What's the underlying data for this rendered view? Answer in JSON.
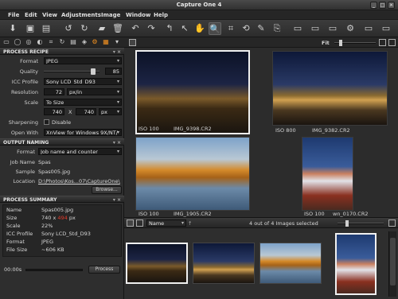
{
  "window": {
    "title": "Capture One 4",
    "buttons": [
      "_",
      "□",
      "×"
    ]
  },
  "menu": [
    "File",
    "Edit",
    "View",
    "Adjustments",
    "Image",
    "Window",
    "Help"
  ],
  "process_recipe": {
    "header": "PROCESS RECIPE",
    "format_label": "Format",
    "format_value": "JPEG",
    "quality_label": "Quality",
    "quality_value": "85",
    "icc_label": "ICC Profile",
    "icc_value": "Sony LCD_Std_D93",
    "resolution_label": "Resolution",
    "resolution_value": "72",
    "resolution_unit": "px/in",
    "scale_label": "Scale",
    "scale_value": "To Size",
    "width_value": "740",
    "x_sep": "X",
    "height_value": "740",
    "size_unit": "px",
    "sharpening_label": "Sharpening",
    "sharpening_value": "Disable",
    "openwith_label": "Open With",
    "openwith_value": "XnView for Windows 9X/NT/"
  },
  "output_naming": {
    "header": "OUTPUT NAMING",
    "format_label": "Format",
    "format_value": "Job name and counter",
    "jobname_label": "Job Name",
    "jobname_value": "Spas",
    "sample_label": "Sample",
    "sample_value": "Spas005.jpg",
    "location_label": "Location",
    "location_value": "D:\\Photos\\Kos...07\\CaptureOne\\",
    "browse_label": "Browse..."
  },
  "process_summary": {
    "header": "PROCESS SUMMARY",
    "rows": [
      {
        "label": "Name",
        "value": "Spas005.jpg"
      },
      {
        "label": "Size",
        "value": "740 x 494 px",
        "w": "740",
        "h": "494",
        "unit": "px"
      },
      {
        "label": "Scale",
        "value": "22%"
      },
      {
        "label": "ICC Profile",
        "value": "Sony LCD_Std_D93"
      },
      {
        "label": "Format",
        "value": "JPEG"
      },
      {
        "label": "File Size",
        "value": "~606 KB"
      }
    ],
    "timer": "00:00s",
    "process_label": "Process"
  },
  "viewer": {
    "fit_label": "Fit",
    "images": [
      {
        "iso": "ISO 100",
        "name": "IMG_9398.CR2"
      },
      {
        "iso": "ISO 800",
        "name": "IMG_9382.CR2"
      },
      {
        "iso": "ISO 100",
        "name": "IMG_1905.CR2"
      },
      {
        "iso": "ISO 100",
        "name": "wn_0170.CR2"
      }
    ]
  },
  "browser": {
    "sort_label": "Name",
    "status": "4 out of 4 Images selected"
  }
}
